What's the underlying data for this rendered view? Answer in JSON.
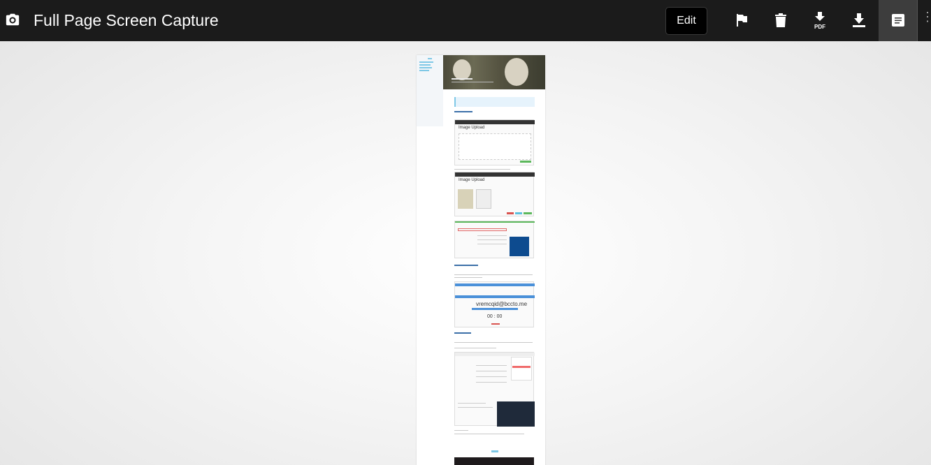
{
  "header": {
    "title": "Full Page Screen Capture",
    "edit_label": "Edit",
    "pdf_label": "PDF"
  },
  "preview": {
    "shot1_title": "Image Upload",
    "shot2_title": "Image Upload",
    "email_text": "vremcqid@bccto.me",
    "timer_text": "00 : 00"
  }
}
